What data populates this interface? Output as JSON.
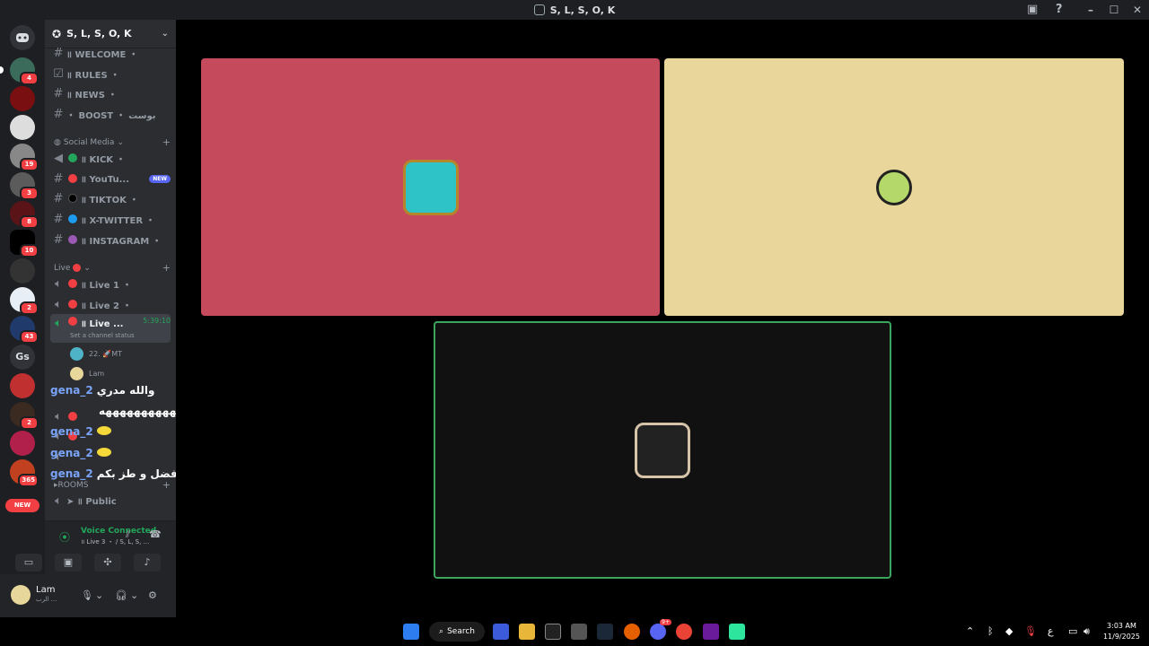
{
  "window": {
    "title": "S, L, S, O, K"
  },
  "servers": {
    "new_label": "NEW",
    "badges": [
      "4",
      "19",
      "3",
      "8",
      "10",
      "2",
      "43",
      "2",
      "365"
    ],
    "text_server": "Gs"
  },
  "guild": {
    "name": "S, L, S, O, K"
  },
  "channels": [
    {
      "name": "॥ WELCOME ・"
    },
    {
      "name": "॥ RULES ・"
    },
    {
      "name": "॥ NEWS ・"
    },
    {
      "name": "・ BOOST ・ بوست"
    }
  ],
  "social_category": "Social Media",
  "social_channels": [
    {
      "name": "॥ KICK ・",
      "color": "#23a55a"
    },
    {
      "name": "॥ YouTu...",
      "color": "#f23f43",
      "tag": "NEW"
    },
    {
      "name": "॥ TIKTOK ・",
      "color": "#000000"
    },
    {
      "name": "॥ X-TWITTER ・",
      "color": "#1d9bf0"
    },
    {
      "name": "॥ INSTAGRAM ・",
      "color": "#9b59b6"
    }
  ],
  "live_category": "Live",
  "live_channels": [
    {
      "name": "॥ Live 1 ・"
    },
    {
      "name": "॥ Live 2 ・"
    },
    {
      "name": "॥ Live ...",
      "time": "5:39:10",
      "status": "Set a channel status"
    }
  ],
  "members": [
    {
      "name": "22. 🚀MT"
    },
    {
      "name": "Lam"
    }
  ],
  "rooms_category": "ROOMS",
  "rooms_channels": [
    {
      "name": "➤ ॥ Public"
    }
  ],
  "overlay_messages": [
    {
      "name": "gena_2",
      "text": "والله مدري"
    },
    {
      "name": "",
      "text": "هههههههههههههههههههه"
    },
    {
      "name": "gena_2",
      "text": ""
    },
    {
      "name": "gena_2",
      "text": ""
    },
    {
      "name": "gena_2",
      "text": "الافضل و طز بكم"
    }
  ],
  "voice": {
    "title": "Voice Connected",
    "subtitle": "॥ Live 3 ・ / S, L, S, ..."
  },
  "user": {
    "name": "Lam",
    "status": "الرب ..."
  },
  "tiles": [
    {
      "color": "#c44a5c",
      "border": ""
    },
    {
      "color": "#e9d69a",
      "border": ""
    },
    {
      "color": "#111111",
      "border": "#3ba55c"
    }
  ],
  "taskbar": {
    "search": "Search",
    "time": "3:03 AM",
    "date": "11/9/2025",
    "lang": "ع",
    "discord_badge": "9+"
  }
}
